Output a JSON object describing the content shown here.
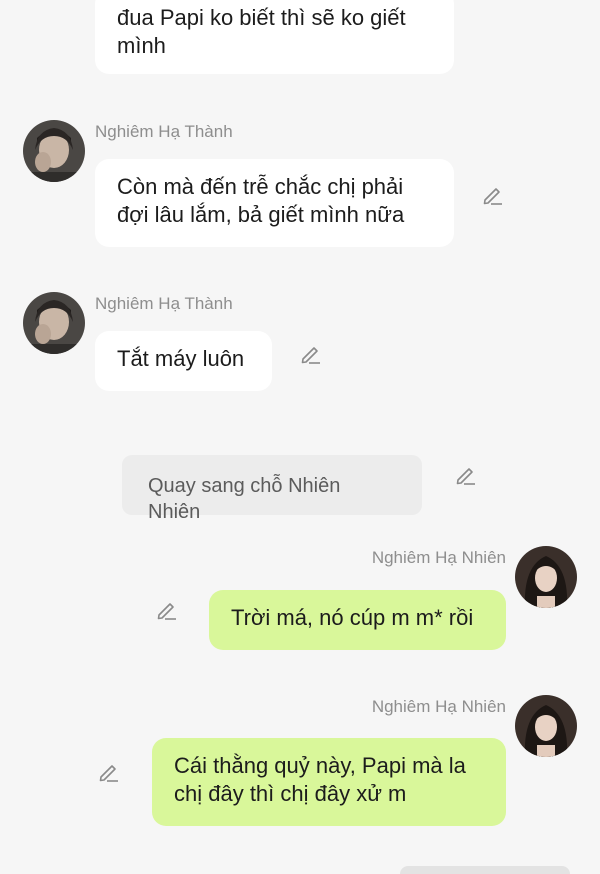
{
  "messages": [
    {
      "text": "đua Papi ko biết thì sẽ ko giết mình"
    },
    {
      "sender": "Nghiêm Hạ Thành",
      "text": "Còn mà đến trễ chắc chị phải đợi lâu lắm, bả giết mình nữa"
    },
    {
      "sender": "Nghiêm Hạ Thành",
      "text": "Tắt máy luôn"
    },
    {
      "narration": "Quay sang chỗ Nhiên Nhiên"
    },
    {
      "sender": "Nghiêm Hạ Nhiên",
      "text": "Trời má, nó cúp m m* rồi"
    },
    {
      "sender": "Nghiêm Hạ Nhiên",
      "text": "Cái thằng quỷ này, Papi mà la chị đây thì chị đây xử m"
    }
  ],
  "colors": {
    "background": "#f6f6f6",
    "left_bubble": "#ffffff",
    "right_bubble": "#d9f79a",
    "name_text": "#8e8e8e",
    "narration_bg": "#ececec"
  },
  "icons": {
    "edit": "pencil-edit-icon",
    "avatar_male": "avatar-icon",
    "avatar_female": "avatar-icon"
  }
}
